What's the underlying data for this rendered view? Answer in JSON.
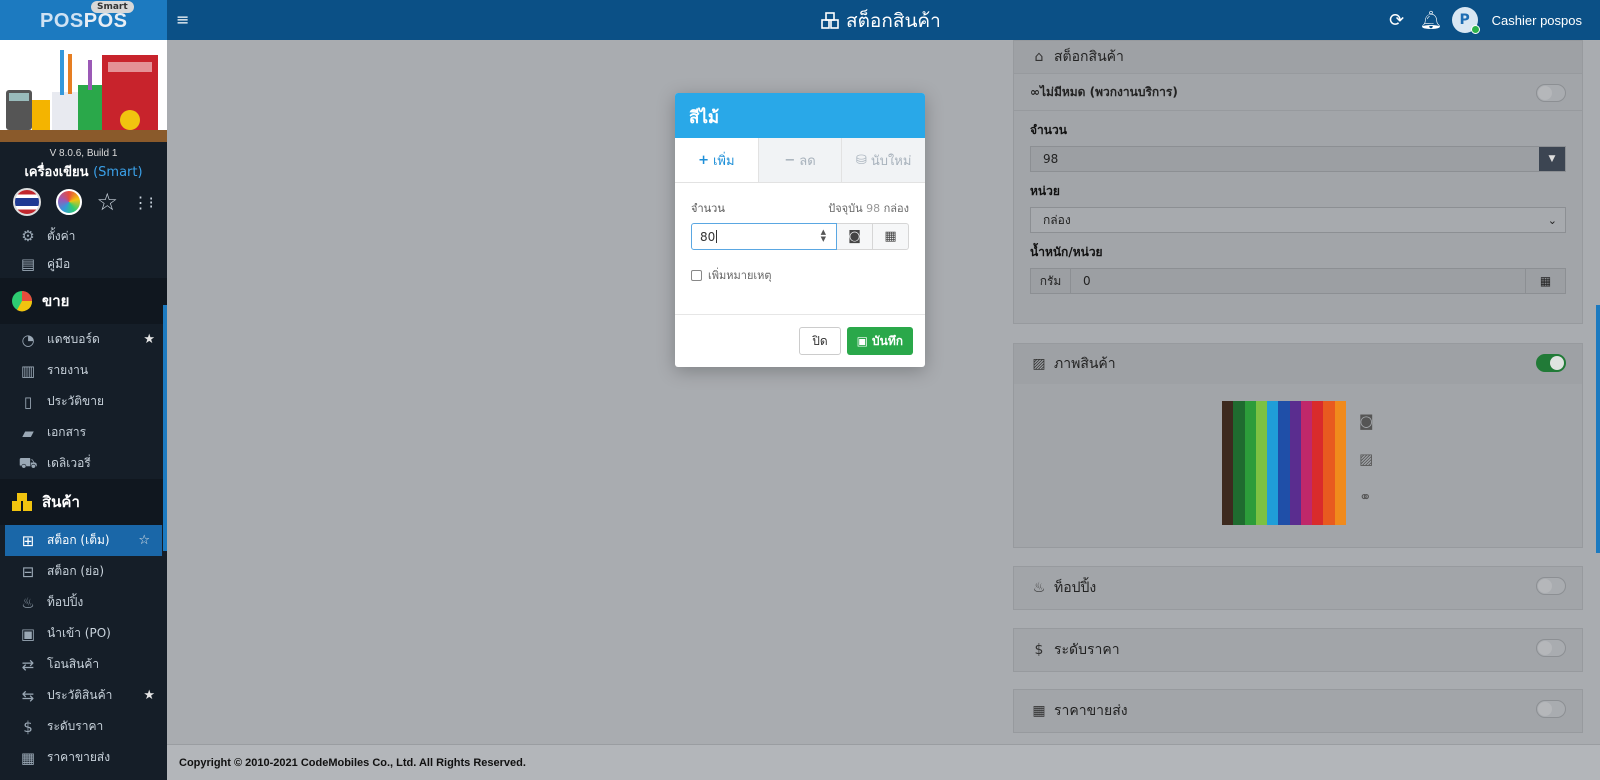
{
  "brand": {
    "logo_left": "POS",
    "logo_right": "POS",
    "badge": "Smart"
  },
  "header": {
    "title": "สต็อกสินค้า",
    "user": "Cashier pospos",
    "avatar_letter": "P"
  },
  "sidebar": {
    "version": "V 8.0.6, Build 1",
    "shop_name": "เครื่องเขียน",
    "shop_tier": "(Smart)",
    "settings_items": [
      {
        "label": "ตั้งค่า",
        "icon": "gear-icon"
      },
      {
        "label": "คู่มือ",
        "icon": "book-icon"
      }
    ],
    "sale_section": "ขาย",
    "sale_items": [
      {
        "label": "แดชบอร์ด",
        "icon": "dashboard-icon",
        "starred": true
      },
      {
        "label": "รายงาน",
        "icon": "report-icon",
        "starred": false
      },
      {
        "label": "ประวัติขาย",
        "icon": "receipt-icon",
        "starred": false
      },
      {
        "label": "เอกสาร",
        "icon": "folder-icon",
        "starred": false
      },
      {
        "label": "เดลิเวอรี่",
        "icon": "delivery-icon",
        "starred": false
      }
    ],
    "product_section": "สินค้า",
    "product_items": [
      {
        "label": "สต็อก (เต็ม)",
        "icon": "stock-full-icon",
        "active": true
      },
      {
        "label": "สต็อก (ย่อ)",
        "icon": "stock-short-icon",
        "active": false
      },
      {
        "label": "ท็อปปิ้ง",
        "icon": "topping-icon",
        "active": false
      },
      {
        "label": "นำเข้า (PO)",
        "icon": "po-icon",
        "active": false
      },
      {
        "label": "โอนสินค้า",
        "icon": "transfer-icon",
        "active": false
      },
      {
        "label": "ประวัติสินค้า",
        "icon": "history-icon",
        "active": false,
        "starred": true
      },
      {
        "label": "ระดับราคา",
        "icon": "price-level-icon",
        "active": false
      },
      {
        "label": "ราคาขายส่ง",
        "icon": "wholesale-icon",
        "active": false
      }
    ]
  },
  "stock_panel": {
    "title": "สต็อกสินค้า",
    "unlimited_label": "∞ไม่มีหมด (พวกงานบริการ)",
    "qty_label": "จำนวน",
    "qty_value": "98",
    "unit_label": "หน่วย",
    "unit_value": "กล่อง",
    "weight_label": "น้ำหนัก/หน่วย",
    "weight_unit": "กรัม",
    "weight_value": "0"
  },
  "image_panel": {
    "title": "ภาพสินค้า",
    "enabled": true
  },
  "topping_panel": {
    "title": "ท็อปปิ้ง"
  },
  "price_level_panel": {
    "title": "ระดับราคา"
  },
  "wholesale_panel": {
    "title": "ราคาขายส่ง"
  },
  "modal": {
    "title": "สีไม้",
    "tabs": [
      {
        "label": "เพิ่ม",
        "icon": "+",
        "active": true
      },
      {
        "label": "ลด",
        "icon": "−",
        "active": false
      },
      {
        "label": "นับใหม่",
        "icon": "⛁",
        "active": false
      }
    ],
    "qty_label": "จำนวน",
    "current_prefix": "ปัจจุบัน",
    "current_value": "98",
    "current_unit": "กล่อง",
    "input_value": "80",
    "note_label": "เพิ่มหมายเหตุ",
    "close_label": "ปิด",
    "save_label": "บันทึก"
  },
  "footer": {
    "text": "Copyright © 2010-2021 CodeMobiles Co., Ltd. All Rights Reserved."
  },
  "colors": {
    "header": "#0b5086",
    "brand": "#1c7ac0",
    "modal_header": "#29a8e8",
    "save": "#2aa84a",
    "active_nav": "#1a67a8"
  }
}
